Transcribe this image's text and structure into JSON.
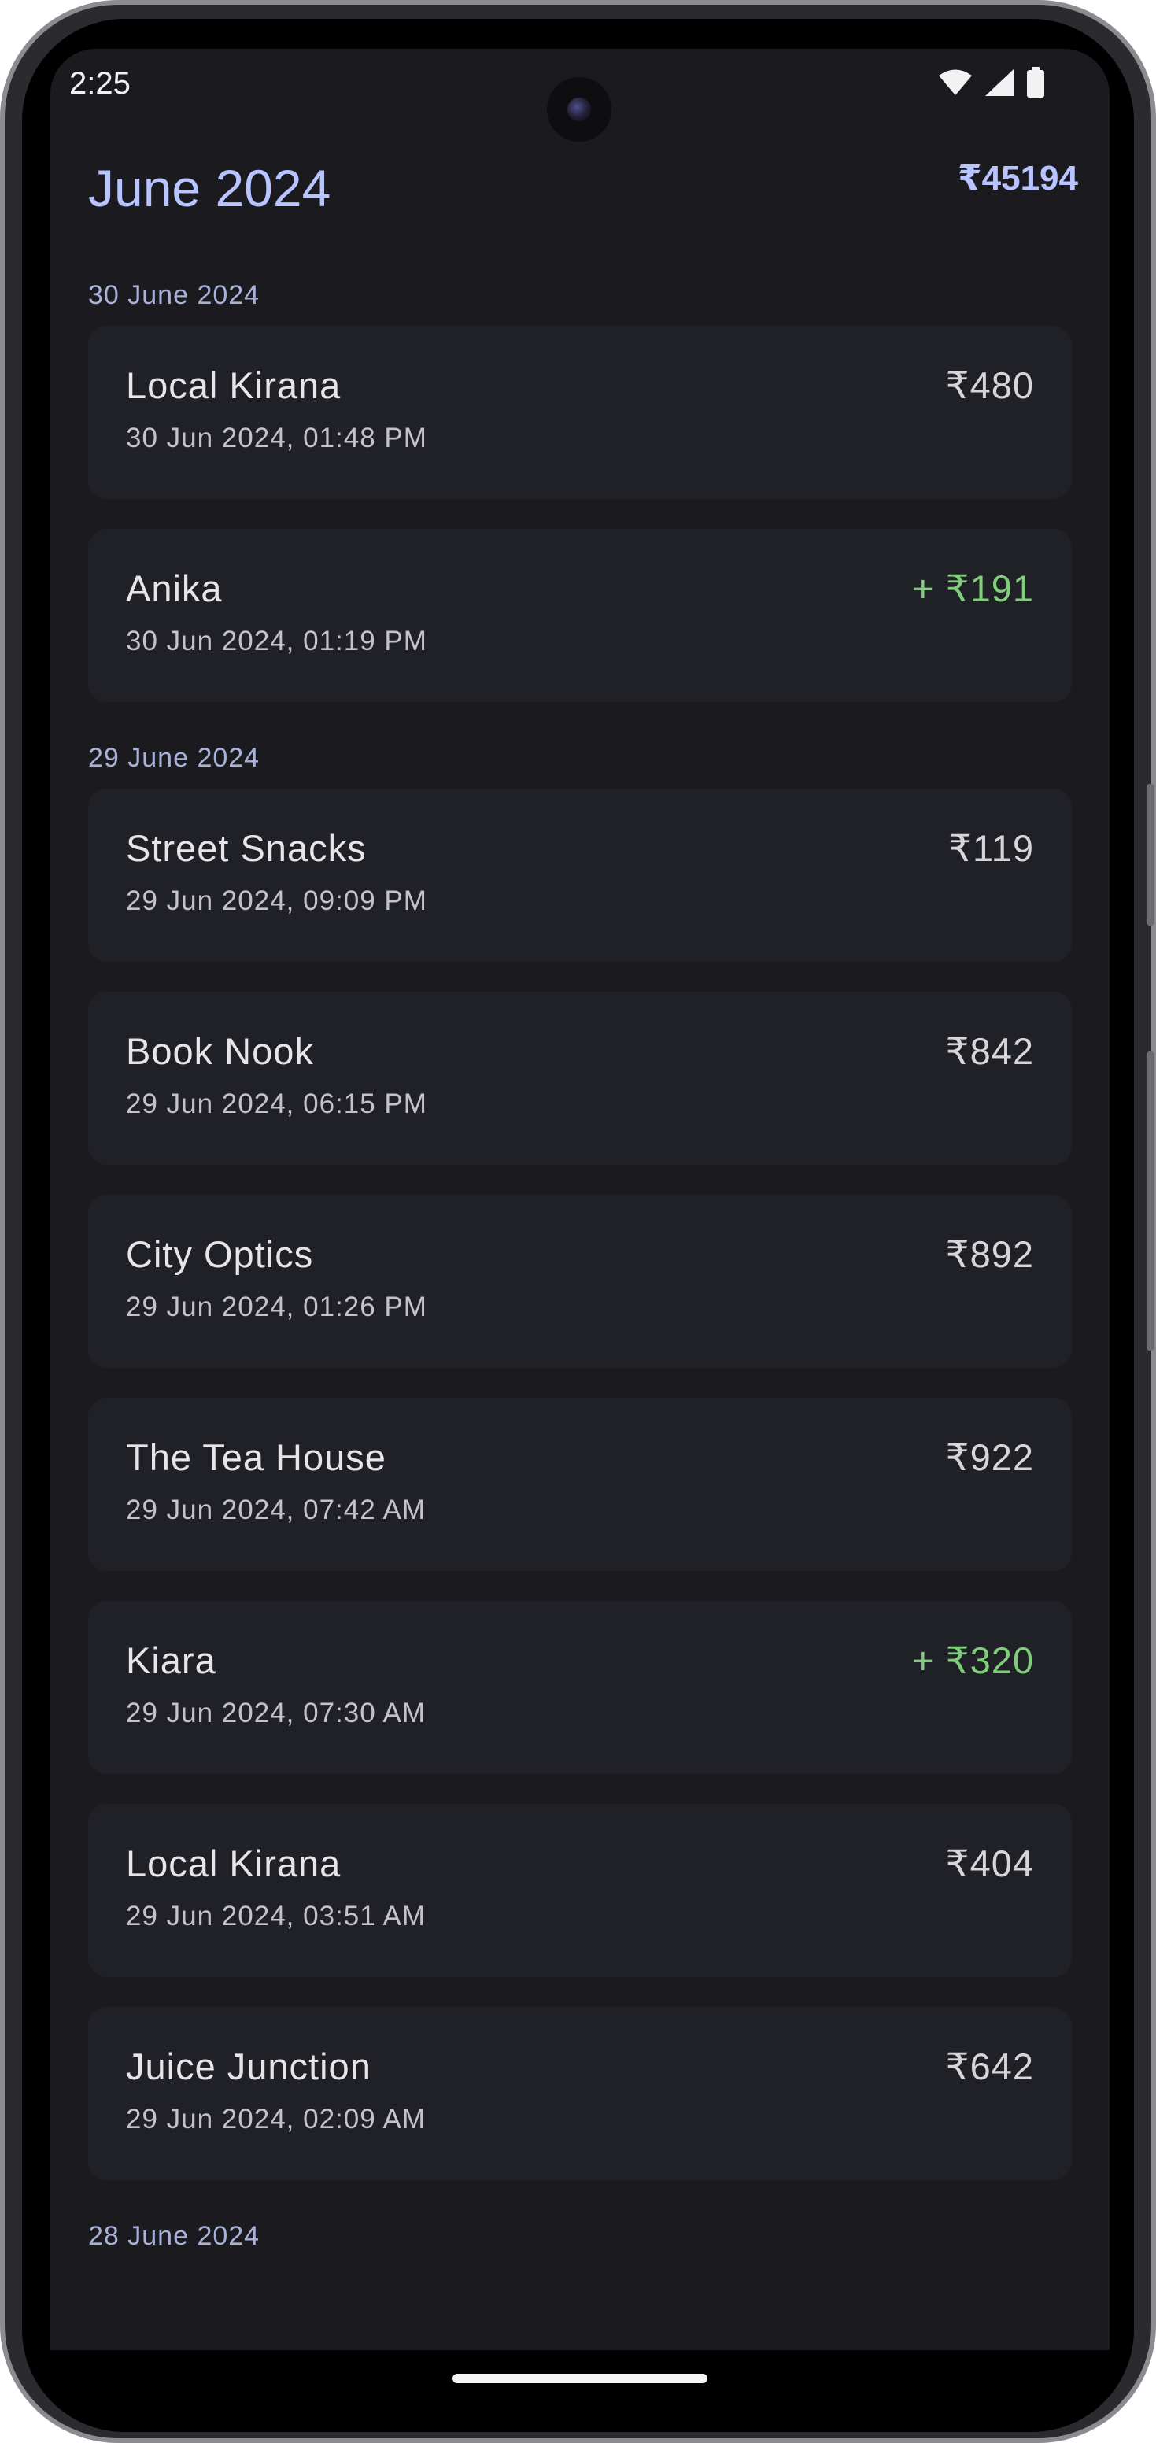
{
  "status_bar": {
    "time": "2:25"
  },
  "header": {
    "title": "June 2024",
    "total": "₹45194"
  },
  "colors": {
    "accent": "#b8c4ff",
    "credit": "#7fcf7a",
    "background": "#1b1b1f",
    "card": "#202126"
  },
  "groups": [
    {
      "date": "30 June 2024",
      "transactions": [
        {
          "merchant": "Local Kirana",
          "timestamp": "30 Jun 2024, 01:48 PM",
          "amount": "₹480",
          "credit": false
        },
        {
          "merchant": "Anika",
          "timestamp": "30 Jun 2024, 01:19 PM",
          "amount": "+ ₹191",
          "credit": true
        }
      ]
    },
    {
      "date": "29 June 2024",
      "transactions": [
        {
          "merchant": "Street Snacks",
          "timestamp": "29 Jun 2024, 09:09 PM",
          "amount": "₹119",
          "credit": false
        },
        {
          "merchant": "Book Nook",
          "timestamp": "29 Jun 2024, 06:15 PM",
          "amount": "₹842",
          "credit": false
        },
        {
          "merchant": "City Optics",
          "timestamp": "29 Jun 2024, 01:26 PM",
          "amount": "₹892",
          "credit": false
        },
        {
          "merchant": "The Tea House",
          "timestamp": "29 Jun 2024, 07:42 AM",
          "amount": "₹922",
          "credit": false
        },
        {
          "merchant": "Kiara",
          "timestamp": "29 Jun 2024, 07:30 AM",
          "amount": "+ ₹320",
          "credit": true
        },
        {
          "merchant": "Local Kirana",
          "timestamp": "29 Jun 2024, 03:51 AM",
          "amount": "₹404",
          "credit": false
        },
        {
          "merchant": "Juice Junction",
          "timestamp": "29 Jun 2024, 02:09 AM",
          "amount": "₹642",
          "credit": false
        }
      ]
    },
    {
      "date": "28 June 2024",
      "transactions": []
    }
  ]
}
